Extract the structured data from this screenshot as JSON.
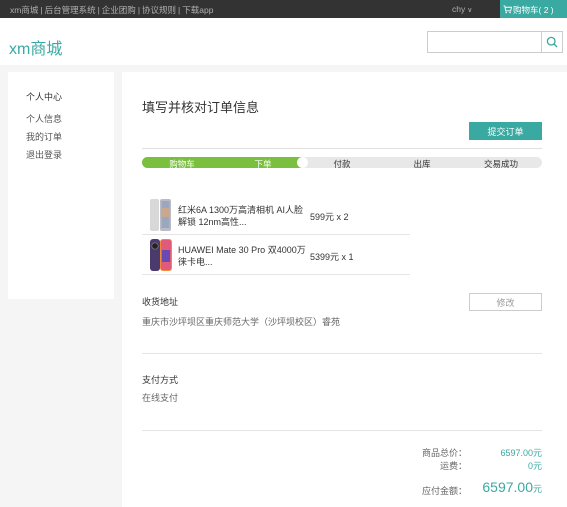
{
  "topbar": {
    "links": [
      "xm商城",
      "后台管理系统",
      "企业团购",
      "协议规则",
      "下载app"
    ],
    "separator": "|",
    "user": "chy",
    "user_caret": "∨",
    "cart_label": "购物车( 2 )"
  },
  "header": {
    "logo": "xm商城",
    "search_placeholder": ""
  },
  "sidebar": {
    "title": "个人中心",
    "items": [
      "个人信息",
      "我的订单",
      "退出登录"
    ]
  },
  "main": {
    "title": "填写并核对订单信息",
    "submit_label": "提交订单",
    "steps": [
      "购物车",
      "下单",
      "付款",
      "出库",
      "交易成功"
    ],
    "steps_completed": 2,
    "products": [
      {
        "name": "红米6A 1300万高清相机 AI人脸解锁 12nm高性...",
        "price": "599元 x 2"
      },
      {
        "name": "HUAWEI Mate 30 Pro 双4000万徕卡电...",
        "price": "5399元 x 1"
      }
    ],
    "address_label": "收货地址",
    "address": "重庆市沙坪坝区重庆师范大学（沙坪坝校区）睿苑",
    "edit_label": "修改",
    "payment_label": "支付方式",
    "payment_value": "在线支付",
    "summary": {
      "goods_total_label": "商品总价：",
      "goods_total": "6597.00元",
      "shipping_label": "运费：",
      "shipping": "0元",
      "payable_label": "应付金额：",
      "payable": "6597.00",
      "payable_unit": "元"
    }
  },
  "colors": {
    "accent": "#3aa9a1",
    "progress": "#7bbf3e",
    "topbar": "#333333"
  }
}
